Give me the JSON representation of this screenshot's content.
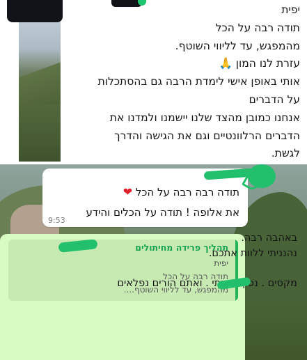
{
  "top_message": {
    "lines": [
      "יפית",
      "תודה רבה על הכל",
      "מהמפגש, עד לליווי השוטף.",
      "עזרת לנו המון 🙏",
      "אותי באופן אישי לימדת הרבה גם בהסתכלות",
      "על הדברים",
      "אנחנו כמובן מהצד שלנו יישמנו ולמדנו את",
      "הדברים הרלוונטיים וגם את הגישה והדרך",
      "לגשת."
    ]
  },
  "incoming_bubble": {
    "line1": "תודה רבה רבה על הכל",
    "line2": "את אלופה ! תודה על הכלים והידע",
    "time": "9:53"
  },
  "outgoing_bubble": {
    "quote": {
      "author": "תהליך פרידה מחיתולים",
      "lines": [
        "יפית",
        "תודה רבה על הכל",
        "מהמפגש, עד לליווי השוטף...."
      ]
    },
    "reply_lines": [
      "באהבה רבה.",
      "נהנניתי ללוות אתכם.",
      "מקסים . נסיך אמיתי . ואתם הורים נפלאים"
    ]
  },
  "colors": {
    "accent_green": "#22c06c",
    "outgoing_bg": "#d8fbc4",
    "quote_author": "#1aa352",
    "heart": "#e0202b"
  }
}
